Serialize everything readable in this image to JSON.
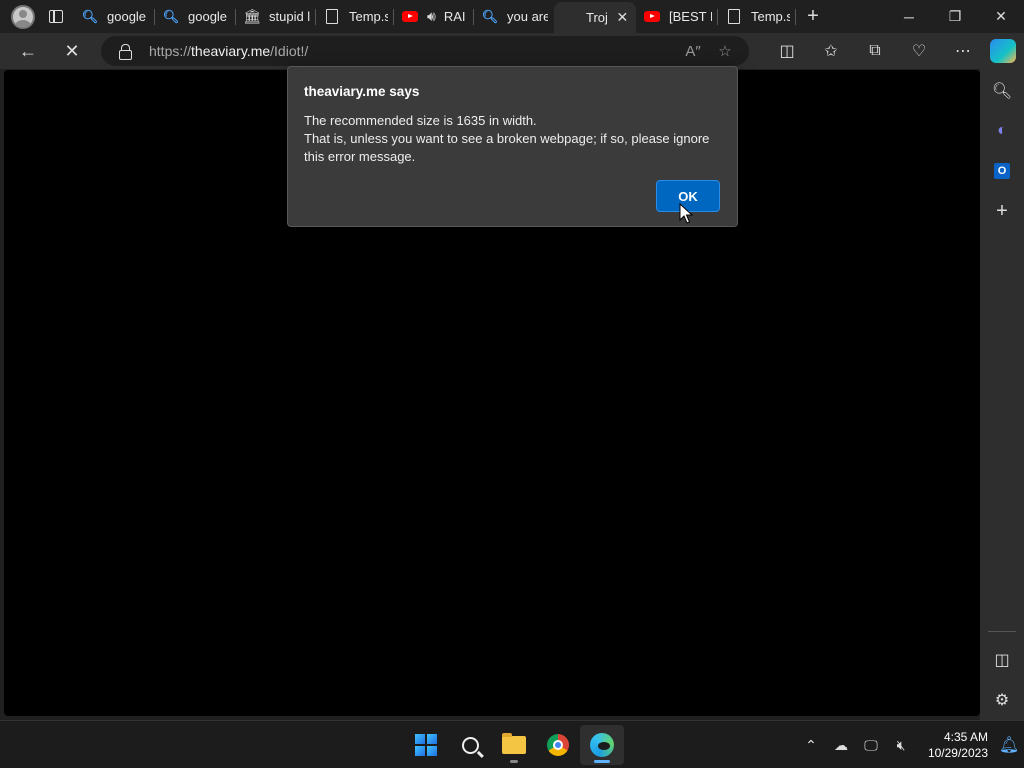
{
  "tabs": [
    {
      "label": "google",
      "icon": "search-icon",
      "active": false
    },
    {
      "label": "google",
      "icon": "search-icon",
      "active": false
    },
    {
      "label": "stupid le",
      "icon": "bank-icon",
      "active": false
    },
    {
      "label": "Temp.sh",
      "icon": "document-icon",
      "active": false
    },
    {
      "label": "RAI",
      "icon": "youtube-icon",
      "active": false
    },
    {
      "label": "you are",
      "icon": "search-icon",
      "active": false
    },
    {
      "label": "Troj",
      "icon": "none",
      "active": true
    },
    {
      "label": "[BEST M",
      "icon": "youtube-icon",
      "active": false
    },
    {
      "label": "Temp.sh",
      "icon": "document-icon",
      "active": false
    }
  ],
  "address_bar": {
    "url_prefix": "https://",
    "url_host": "theaviary.me",
    "url_path": "/Idiot!/"
  },
  "dialog": {
    "title": "theaviary.me says",
    "line1": "The recommended size is 1635 in width.",
    "line2": "That is, unless you want to see a broken webpage; if so, please ignore this error message.",
    "ok_label": "OK"
  },
  "taskbar": {
    "time": "4:35 AM",
    "date": "10/29/2023",
    "apps": [
      "windows-start-icon",
      "search-icon",
      "file-explorer-icon",
      "chrome-icon",
      "edge-icon"
    ]
  },
  "colors": {
    "accent_button": "#0067c0",
    "page_background": "#000000",
    "chrome_background": "#2e2e2e"
  }
}
